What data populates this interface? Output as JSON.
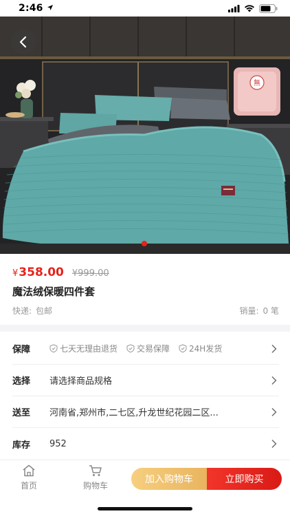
{
  "status_bar": {
    "time": "2:46"
  },
  "product": {
    "currency": "¥",
    "price": "358.00",
    "original_price": "¥999.00",
    "title": "魔法绒保暖四件套",
    "shipping_label": "快递:",
    "shipping_value": "包邮",
    "sales_label": "销量:",
    "sales_value": "0 笔"
  },
  "info": {
    "guarantee": {
      "label": "保障",
      "items": [
        "七天无理由退货",
        "交易保障",
        "24H发货"
      ]
    },
    "select": {
      "label": "选择",
      "value": "请选择商品规格"
    },
    "ship_to": {
      "label": "送至",
      "value": "河南省,郑州市,二七区,升龙世纪花园二区..."
    },
    "stock": {
      "label": "库存",
      "value": "952"
    }
  },
  "bottom_bar": {
    "home_label": "首页",
    "cart_label": "购物车",
    "add_to_cart": "加入购物车",
    "buy_now": "立即购买"
  },
  "colors": {
    "accent_red": "#e5231b",
    "cart_gold": "#eebf6a",
    "bedding_teal": "#5fa9a8"
  },
  "icons": [
    "location-arrow-icon",
    "signal-icon",
    "wifi-icon",
    "battery-icon",
    "back-arrow-icon",
    "shield-check-icon",
    "chevron-right-icon",
    "home-icon",
    "cart-icon"
  ],
  "carousel": {
    "current_index": 1,
    "count": 1
  }
}
